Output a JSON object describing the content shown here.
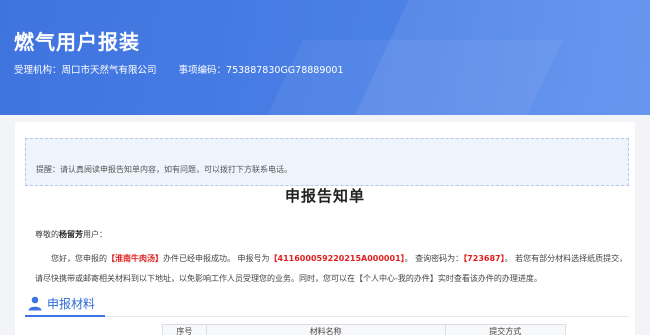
{
  "header": {
    "title": "燃气用户报装",
    "agency_label": "受理机构：",
    "agency": "周口市天然气有限公司",
    "code_label": "事项编码：",
    "code": "753887830GG78889001"
  },
  "notice": "提醒：请认真阅读申报告知单内容，如有问题，可以拨打下方联系电话。",
  "doc": {
    "title": "申报告知单",
    "greeting_prefix": "尊敬的",
    "user_name": "杨留芳",
    "greeting_suffix": "用户：",
    "p1": "您好，您申报的",
    "item": "【淮南牛肉汤】",
    "p2": "办件已经申报成功。 申报号为",
    "apply_no": "【411600059220215A000001】",
    "p3": "。 查询密码为：",
    "password": "【723687】",
    "p4": "。 若您有部分材料选择纸质提交，请尽快携带或邮寄相关材料到以下地址，以免影响工作人员受理您的业务。同时，您可以在【个人中心-我的办件】实时查看该办件的办理进度。"
  },
  "materials": {
    "section_title": "申报材料",
    "columns": [
      "序号",
      "材料名称",
      "提交方式"
    ]
  },
  "colors": {
    "banner": "#4a7fe6",
    "accent": "#2d6ad7",
    "highlight": "#e02020"
  }
}
